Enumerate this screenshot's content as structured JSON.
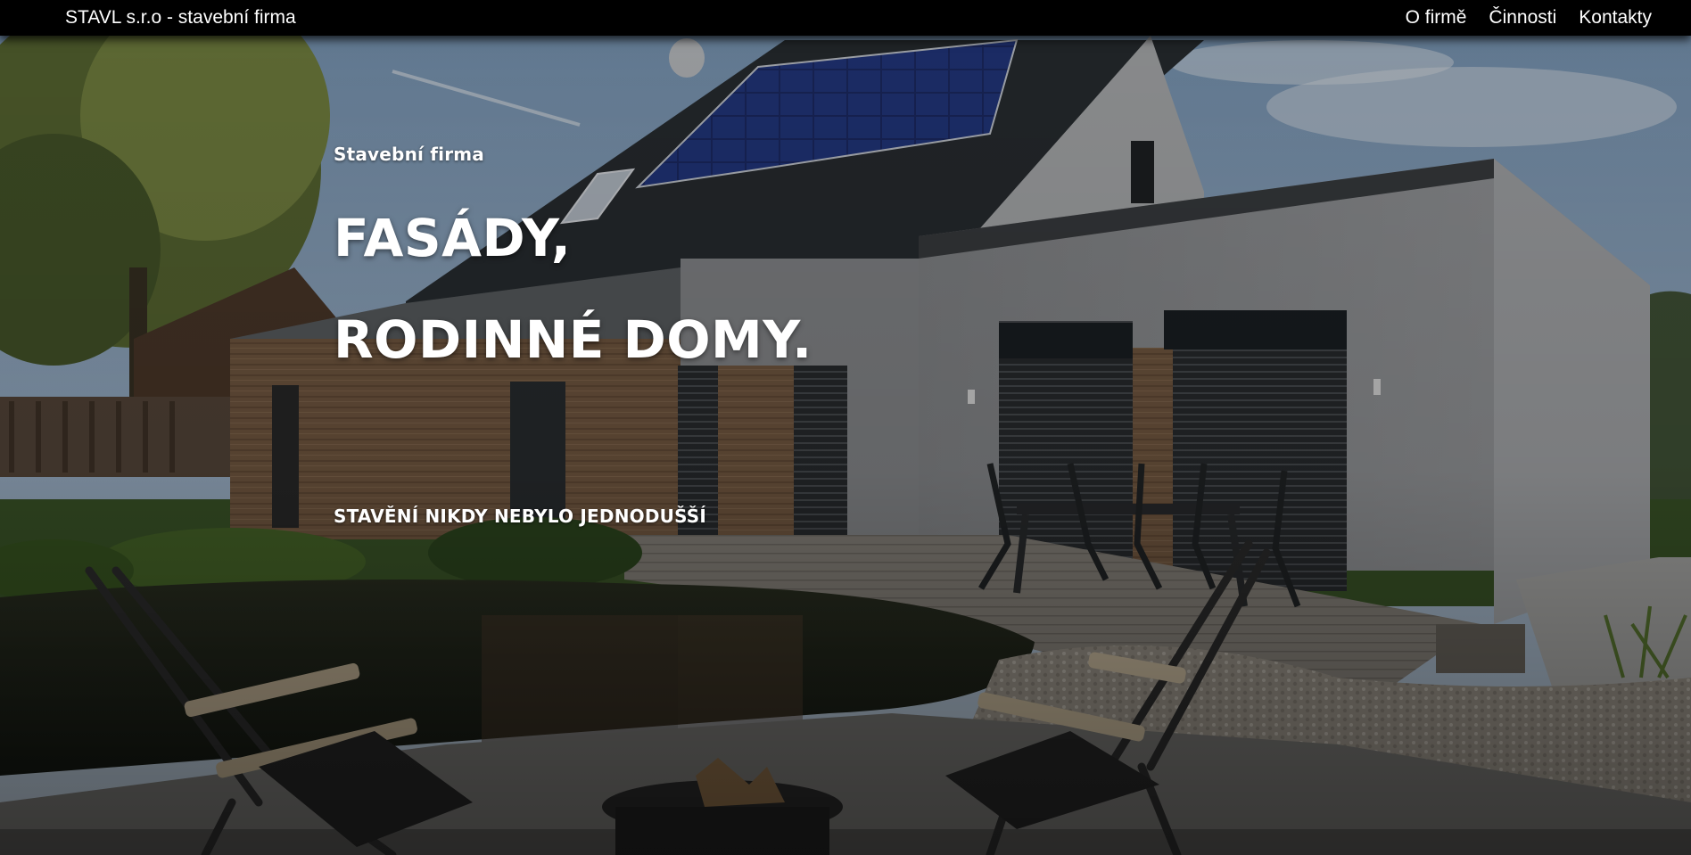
{
  "navbar": {
    "brand": "STAVL s.r.o - stavební firma",
    "links": [
      {
        "label": "O firmě"
      },
      {
        "label": "Činnosti"
      },
      {
        "label": "Kontakty"
      }
    ]
  },
  "hero": {
    "eyebrow": "Stavební firma",
    "headline_line1": "FASÁDY,",
    "headline_line2": "RODINNÉ DOMY.",
    "tagline": "STAVĚNÍ NIKDY NEBYLO JEDNODUŠŠÍ",
    "image_alt": "Modern family house with solar panels, wooden facade, terrace and garden pond"
  },
  "colors": {
    "navbar_bg": "#000000",
    "text": "#ffffff"
  }
}
